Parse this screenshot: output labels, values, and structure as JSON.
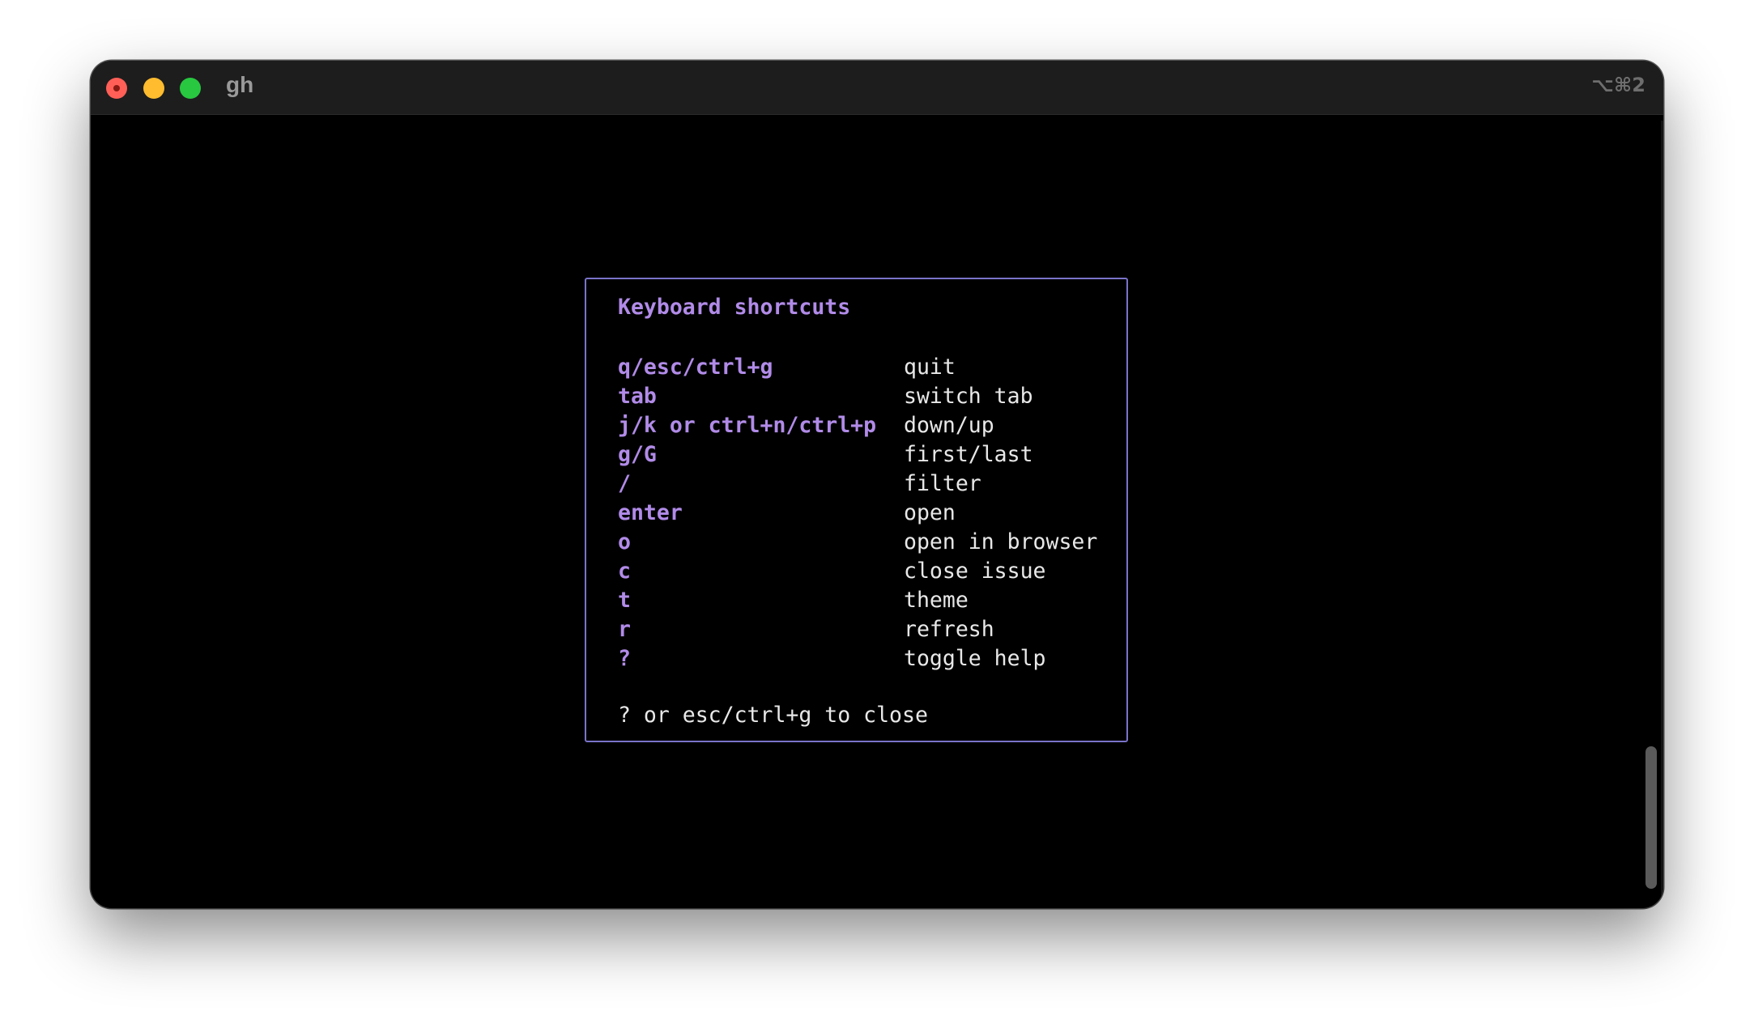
{
  "window": {
    "title": "gh",
    "shortcut_hint": "⌥⌘2"
  },
  "help": {
    "title": "Keyboard shortcuts",
    "shortcuts": [
      {
        "key": "q/esc/ctrl+g",
        "desc": "quit"
      },
      {
        "key": "tab",
        "desc": "switch tab"
      },
      {
        "key": "j/k or ctrl+n/ctrl+p",
        "desc": "down/up"
      },
      {
        "key": "g/G",
        "desc": "first/last"
      },
      {
        "key": "/",
        "desc": "filter"
      },
      {
        "key": "enter",
        "desc": "open"
      },
      {
        "key": "o",
        "desc": "open in browser"
      },
      {
        "key": "c",
        "desc": "close issue"
      },
      {
        "key": "t",
        "desc": "theme"
      },
      {
        "key": "r",
        "desc": "refresh"
      },
      {
        "key": "?",
        "desc": "toggle help"
      }
    ],
    "footer": "? or esc/ctrl+g to close"
  },
  "colors": {
    "accent": "#b18be8",
    "border": "#7a73c9",
    "background": "#000000",
    "text": "#e8e8e8"
  }
}
